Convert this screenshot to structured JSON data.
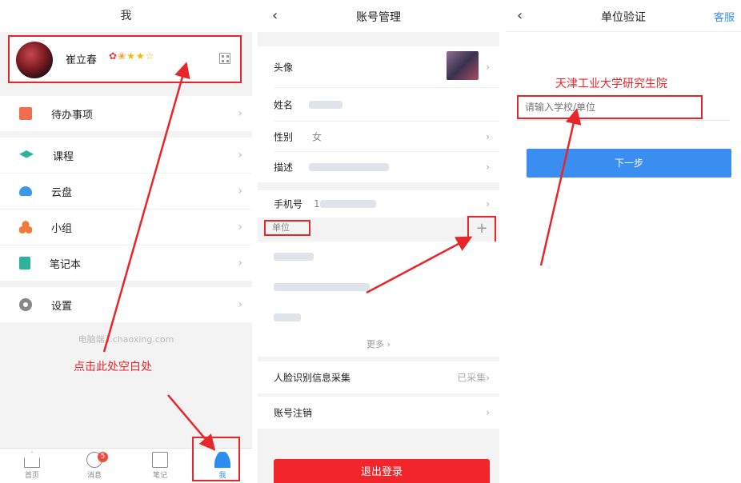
{
  "panel1": {
    "title": "我",
    "user_name": "崔立春",
    "badges": [
      "✿",
      "❀",
      "★",
      "★",
      "☆"
    ],
    "menu": [
      {
        "label": "待办事项",
        "icon": "todo-icon"
      },
      {
        "label": "课程",
        "icon": "course-icon"
      },
      {
        "label": "云盘",
        "icon": "cloud-icon"
      },
      {
        "label": "小组",
        "icon": "group-icon"
      },
      {
        "label": "笔记本",
        "icon": "notebook-icon"
      },
      {
        "label": "设置",
        "icon": "gear-icon"
      }
    ],
    "site": "电脑端 i.chaoxing.com",
    "hint": "点击此处空白处",
    "tabs": [
      {
        "label": "首页"
      },
      {
        "label": "消息",
        "badge": "5"
      },
      {
        "label": "笔记"
      },
      {
        "label": "我"
      }
    ],
    "chevron": "›"
  },
  "panel2": {
    "title": "账号管理",
    "back": "‹",
    "rows": {
      "avatar": "头像",
      "name": "姓名",
      "gender": "性别",
      "gender_value": "女",
      "desc": "描述",
      "phone": "手机号",
      "phone_value": "1",
      "unit": "单位",
      "plus": "+",
      "more": "更多 ›",
      "face": "人脸识别信息采集",
      "face_value": "已采集›",
      "cancel": "账号注销",
      "logout": "退出登录"
    }
  },
  "panel3": {
    "title": "单位验证",
    "back": "‹",
    "service": "客服",
    "red_note": "天津工业大学研究生院",
    "placeholder": "请输入学校/单位",
    "next": "下一步"
  },
  "colors": {
    "accent": "#e8262a",
    "blue": "#3a8ef0"
  }
}
